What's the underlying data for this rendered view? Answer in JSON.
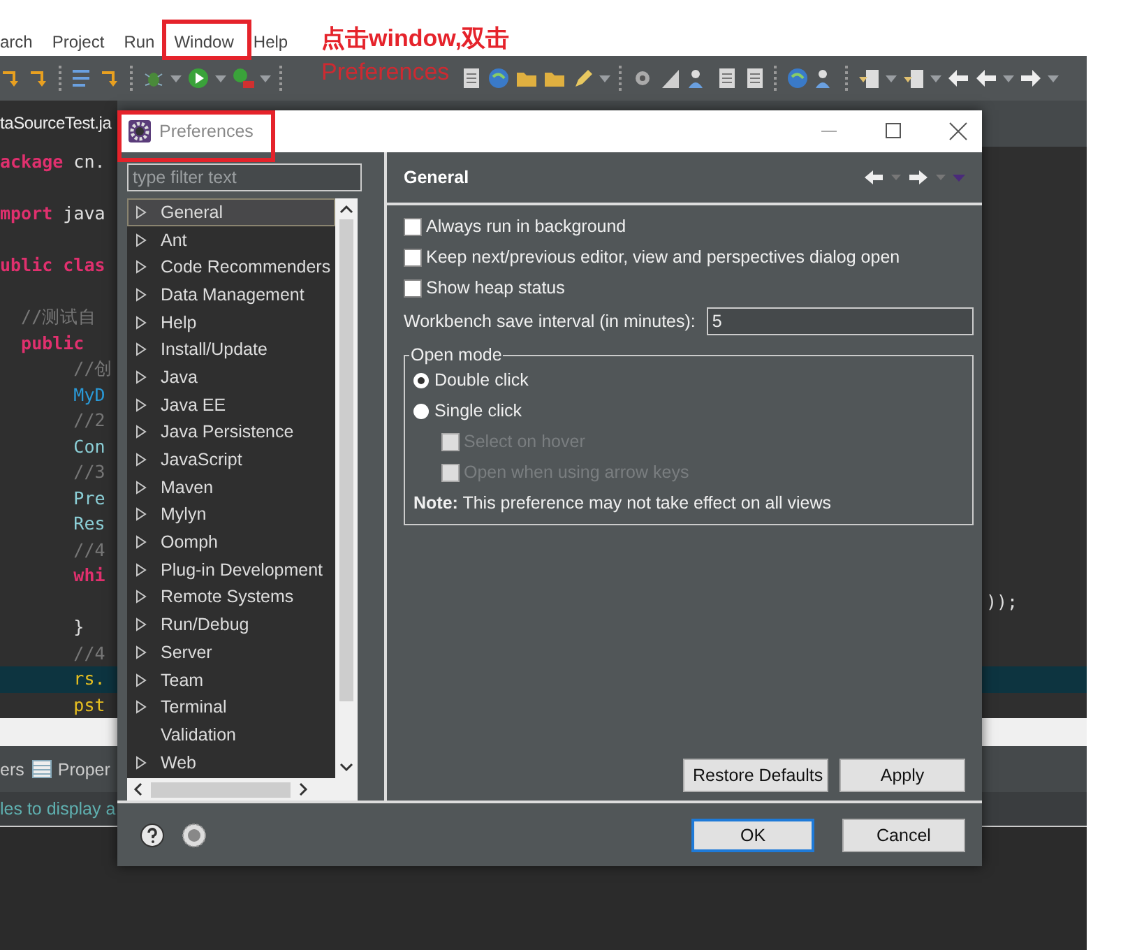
{
  "menu_bar": [
    {
      "label": "arch"
    },
    {
      "label": "Project"
    },
    {
      "label": "Run"
    },
    {
      "label": "Window"
    },
    {
      "label": "Help"
    }
  ],
  "annotation": {
    "lines": [
      "点击window,双击",
      "Preferences"
    ]
  },
  "editor": {
    "tab": "taSourceTest.ja",
    "lines": [
      {
        "gap_before": false,
        "current": false,
        "tokens": [
          {
            "text": "ackage",
            "kind": "keyword"
          },
          {
            "text": " cn.",
            "kind": "plain"
          }
        ]
      },
      {
        "gap_before": true,
        "current": false,
        "tokens": [
          {
            "text": "mport",
            "kind": "keyword"
          },
          {
            "text": " java",
            "kind": "plain"
          }
        ]
      },
      {
        "gap_before": true,
        "current": false,
        "tokens": [
          {
            "text": "ublic clas",
            "kind": "keyword"
          }
        ]
      },
      {
        "gap_before": true,
        "current": false,
        "tokens": [
          {
            "text": "  //测试自",
            "kind": "comment"
          }
        ]
      },
      {
        "gap_before": false,
        "current": false,
        "tokens": [
          {
            "text": "  public",
            "kind": "keyword"
          }
        ]
      },
      {
        "gap_before": false,
        "current": false,
        "tokens": [
          {
            "text": "       //创",
            "kind": "comment"
          }
        ]
      },
      {
        "gap_before": false,
        "current": false,
        "tokens": [
          {
            "text": "       MyD",
            "kind": "type"
          }
        ]
      },
      {
        "gap_before": false,
        "current": false,
        "tokens": [
          {
            "text": "       //2",
            "kind": "comment"
          }
        ]
      },
      {
        "gap_before": false,
        "current": false,
        "tokens": [
          {
            "text": "       Con",
            "kind": "field"
          }
        ]
      },
      {
        "gap_before": false,
        "current": false,
        "tokens": [
          {
            "text": "       //3",
            "kind": "comment"
          }
        ]
      },
      {
        "gap_before": false,
        "current": false,
        "tokens": [
          {
            "text": "       Pre",
            "kind": "field"
          }
        ]
      },
      {
        "gap_before": false,
        "current": false,
        "tokens": [
          {
            "text": "       Res",
            "kind": "field"
          }
        ]
      },
      {
        "gap_before": false,
        "current": false,
        "tokens": [
          {
            "text": "       //4",
            "kind": "comment"
          }
        ]
      },
      {
        "gap_before": false,
        "current": false,
        "tokens": [
          {
            "text": "       whi",
            "kind": "keyword"
          }
        ]
      },
      {
        "gap_before": false,
        "current": false,
        "tokens": [
          {
            "text": "));",
            "kind": "tail"
          }
        ]
      },
      {
        "gap_before": false,
        "current": false,
        "tokens": [
          {
            "text": "       }",
            "kind": "plain"
          }
        ]
      },
      {
        "gap_before": false,
        "current": false,
        "tokens": [
          {
            "text": "       //4",
            "kind": "comment"
          }
        ]
      },
      {
        "gap_before": false,
        "current": true,
        "tokens": [
          {
            "text": "       rs.",
            "kind": "var"
          }
        ]
      },
      {
        "gap_before": false,
        "current": false,
        "tokens": [
          {
            "text": "       pst",
            "kind": "var"
          }
        ]
      }
    ]
  },
  "bottom_panel": {
    "tabs": [
      {
        "label": "ers",
        "icon": false
      },
      {
        "label": "Proper",
        "icon": true
      }
    ],
    "message": "les to display a"
  },
  "dialog": {
    "title": "Preferences",
    "filter": {
      "placeholder": "type filter text"
    },
    "tree": [
      {
        "label": "General",
        "selected": true,
        "expandable": true
      },
      {
        "label": "Ant",
        "selected": false,
        "expandable": true
      },
      {
        "label": "Code Recommenders",
        "selected": false,
        "expandable": true
      },
      {
        "label": "Data Management",
        "selected": false,
        "expandable": true
      },
      {
        "label": "Help",
        "selected": false,
        "expandable": true
      },
      {
        "label": "Install/Update",
        "selected": false,
        "expandable": true
      },
      {
        "label": "Java",
        "selected": false,
        "expandable": true
      },
      {
        "label": "Java EE",
        "selected": false,
        "expandable": true
      },
      {
        "label": "Java Persistence",
        "selected": false,
        "expandable": true
      },
      {
        "label": "JavaScript",
        "selected": false,
        "expandable": true
      },
      {
        "label": "Maven",
        "selected": false,
        "expandable": true
      },
      {
        "label": "Mylyn",
        "selected": false,
        "expandable": true
      },
      {
        "label": "Oomph",
        "selected": false,
        "expandable": true
      },
      {
        "label": "Plug-in Development",
        "selected": false,
        "expandable": true
      },
      {
        "label": "Remote Systems",
        "selected": false,
        "expandable": true
      },
      {
        "label": "Run/Debug",
        "selected": false,
        "expandable": true
      },
      {
        "label": "Server",
        "selected": false,
        "expandable": true
      },
      {
        "label": "Team",
        "selected": false,
        "expandable": true
      },
      {
        "label": "Terminal",
        "selected": false,
        "expandable": true
      },
      {
        "label": "Validation",
        "selected": false,
        "expandable": false
      },
      {
        "label": "Web",
        "selected": false,
        "expandable": true
      }
    ],
    "page": {
      "title": "General",
      "checkboxes": [
        {
          "label": "Always run in background",
          "checked": false
        },
        {
          "label": "Keep next/previous editor, view and perspectives dialog open",
          "checked": false
        },
        {
          "label": "Show heap status",
          "checked": false
        }
      ],
      "interval": {
        "label": "Workbench save interval (in minutes):",
        "value": "5"
      },
      "open_mode": {
        "title": "Open mode",
        "radios": [
          {
            "label": "Double click",
            "selected": true
          },
          {
            "label": "Single click",
            "selected": false
          }
        ],
        "sub_options": [
          {
            "label": "Select on hover",
            "checked": false,
            "disabled": true
          },
          {
            "label": "Open when using arrow keys",
            "checked": false,
            "disabled": true
          }
        ],
        "note": "**Note:** This preference may not take effect on all views"
      },
      "buttons": [
        "Restore Defaults",
        "Apply"
      ]
    },
    "footer_buttons": [
      {
        "label": "OK",
        "default": true
      },
      {
        "label": "Cancel",
        "default": false
      }
    ]
  }
}
